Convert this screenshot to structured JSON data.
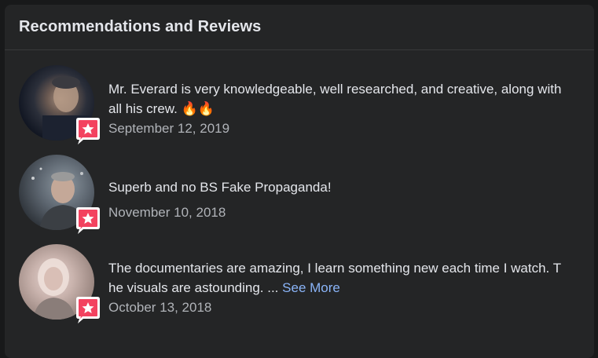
{
  "card": {
    "title": "Recommendations and Reviews"
  },
  "reviews": [
    {
      "text": "Mr. Everard is very knowledgeable, well researched, and creative, along with all his crew. 🔥🔥",
      "date": "September 12, 2019",
      "badge_icon": "recommend-star-icon"
    },
    {
      "text": "Superb and no BS Fake Propaganda!",
      "date": "November 10, 2018",
      "badge_icon": "recommend-star-icon"
    },
    {
      "text": "The documentaries are amazing, I learn something new each time I watch. The visuals are astounding. ...",
      "see_more": "See More",
      "date": "October 13, 2018",
      "badge_icon": "recommend-star-icon"
    }
  ],
  "colors": {
    "badge": "#f3425f",
    "link": "#8ab4f8",
    "background": "#242526"
  }
}
